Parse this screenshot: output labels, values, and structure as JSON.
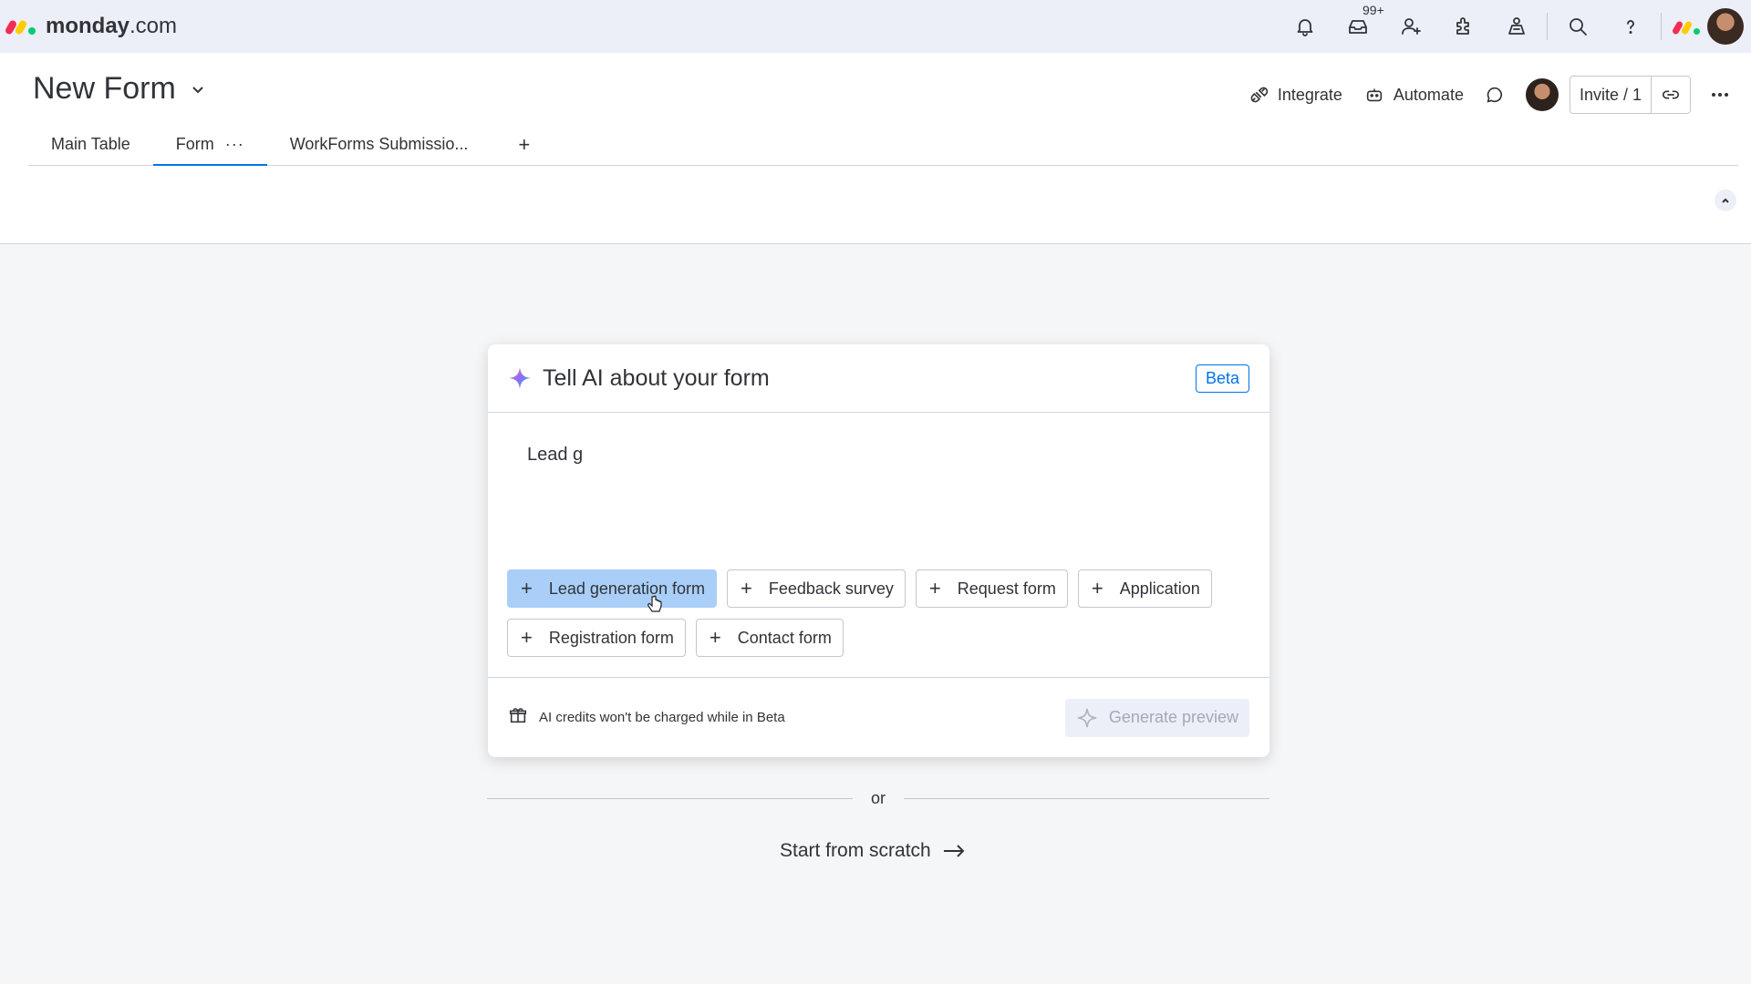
{
  "brand": {
    "name_bold": "monday",
    "name_suffix": ".com",
    "colors": [
      "#f62b54",
      "#ffcc00",
      "#00ca72"
    ]
  },
  "topbar": {
    "icons": [
      "bell-icon",
      "inbox-icon",
      "invite-member-icon",
      "apps-icon",
      "marketplace-icon",
      "search-icon",
      "help-icon"
    ],
    "inbox_badge": "99+"
  },
  "board": {
    "title": "New Form",
    "actions": {
      "integrate": "Integrate",
      "automate": "Automate",
      "invite": "Invite / 1"
    },
    "tabs": [
      {
        "label": "Main Table",
        "active": false
      },
      {
        "label": "Form",
        "active": true,
        "menu": "···"
      },
      {
        "label": "WorkForms Submissio...",
        "active": false
      }
    ],
    "add_tab": "+"
  },
  "ai_card": {
    "title": "Tell AI about your form",
    "beta_label": "Beta",
    "prompt_value": "Lead g",
    "suggestions_row1": [
      "Lead generation form",
      "Feedback survey",
      "Request form",
      "Application"
    ],
    "suggestions_row2": [
      "Registration form",
      "Contact form"
    ],
    "selected_suggestion": "Lead generation form",
    "footer_note": "AI credits won't be charged while in Beta",
    "generate_label": "Generate preview"
  },
  "divider_text": "or",
  "start_from_scratch": "Start from scratch",
  "colors": {
    "accent": "#0073ea",
    "selected_chip": "#a9cff8",
    "topbar_bg": "#eceff8",
    "page_bg": "#f5f6f8"
  }
}
